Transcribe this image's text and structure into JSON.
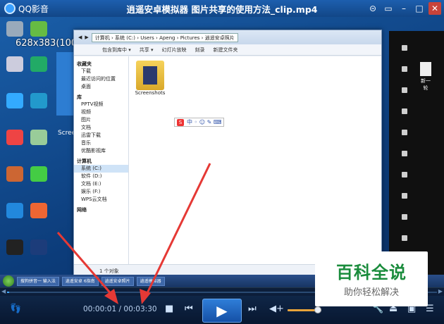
{
  "titlebar": {
    "app_name": "QQ影音",
    "title": "逍遥安卓模拟器 图片共享的使用方法_clip.mp4",
    "buttons": [
      "skin-icon",
      "mini-icon",
      "minimize-icon",
      "maximize-icon",
      "close-icon"
    ]
  },
  "video": {
    "size_overlay": "628x383(100%)",
    "address": "计算机 › 系统 (C:) › Users › Apeng › Pictures › 逍遥安卓照片",
    "toolbar": [
      "包含到库中 ▾",
      "共享 ▾",
      "幻灯片放映",
      "刻录",
      "新建文件夹"
    ],
    "nav": {
      "favorites_head": "收藏夹",
      "favorites": [
        "下载",
        "最近访问的位置",
        "桌面"
      ],
      "libraries_head": "库",
      "libraries": [
        "PPTV视频",
        "视频",
        "图片",
        "文档",
        "迅雷下载",
        "音乐",
        "优酷影视库"
      ],
      "computer_head": "计算机",
      "computer": [
        "系统 (C:)",
        "软件 (D:)",
        "文档 (E:)",
        "娱乐 (F:)",
        "WPS云文档"
      ],
      "network_head": "网络"
    },
    "folder_label": "Screenshots",
    "status": "1 个对象",
    "side_text": "Scree",
    "doc_label": "新一轮",
    "taskbar": [
      "搜狗拼音一 输入法",
      "逍遥安卓 6指南",
      "逍遥安卓照片",
      "逍遥模拟器"
    ]
  },
  "watermark": {
    "line1": "百科全说",
    "line2": "助你轻松解决"
  },
  "progress": {
    "fraction": 0.0048
  },
  "controls": {
    "current": "00:00:01",
    "separator": " / ",
    "total": "00:03:30",
    "volume": 0.9
  },
  "colors": {
    "accent": "#3fa9ff",
    "arrow": "#e53935",
    "watermark_green": "#1a8c3c"
  }
}
